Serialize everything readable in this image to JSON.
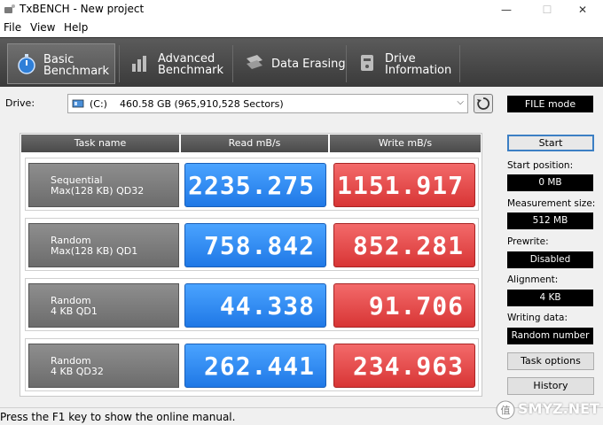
{
  "window": {
    "title": "TxBENCH - New project",
    "minimize": "—",
    "maximize": "☐",
    "close": "✕"
  },
  "menu": {
    "items": [
      "File",
      "View",
      "Help"
    ]
  },
  "toolbar": {
    "tabs": [
      {
        "label": "Basic\nBenchmark",
        "icon": "stopwatch-icon",
        "active": true
      },
      {
        "label": "Advanced\nBenchmark",
        "icon": "bar-chart-icon",
        "active": false
      },
      {
        "label": "Data Erasing",
        "icon": "eraser-icon",
        "active": false
      },
      {
        "label": "Drive\nInformation",
        "icon": "drive-info-icon",
        "active": false
      }
    ]
  },
  "drive": {
    "label": "Drive:",
    "selected": "(C:)    460.58 GB (965,910,528 Sectors)",
    "mode": "FILE mode"
  },
  "results": {
    "headers": {
      "task": "Task name",
      "read": "Read mB/s",
      "write": "Write mB/s"
    },
    "rows": [
      {
        "line1": "Sequential",
        "line2": "Max(128 KB) QD32",
        "read": "2235.275",
        "write": "1151.917"
      },
      {
        "line1": "Random",
        "line2": "Max(128 KB) QD1",
        "read": "758.842",
        "write": "852.281"
      },
      {
        "line1": "Random",
        "line2": "4 KB QD1",
        "read": "44.338",
        "write": "91.706"
      },
      {
        "line1": "Random",
        "line2": "4 KB QD32",
        "read": "262.441",
        "write": "234.963"
      }
    ]
  },
  "settings": {
    "start_label": "Start",
    "start_position_label": "Start position:",
    "start_position_value": "0 MB",
    "measurement_size_label": "Measurement size:",
    "measurement_size_value": "512 MB",
    "prewrite_label": "Prewrite:",
    "prewrite_value": "Disabled",
    "alignment_label": "Alignment:",
    "alignment_value": "4 KB",
    "writing_data_label": "Writing data:",
    "writing_data_value": "Random number",
    "task_options_label": "Task options",
    "history_label": "History"
  },
  "status": {
    "text": "Press the F1 key to show the online manual."
  },
  "watermark": {
    "text": "SMYZ.NET"
  },
  "colors": {
    "read": "#2b86f0",
    "write": "#e04545",
    "toolbar": "#4a4a4a"
  }
}
